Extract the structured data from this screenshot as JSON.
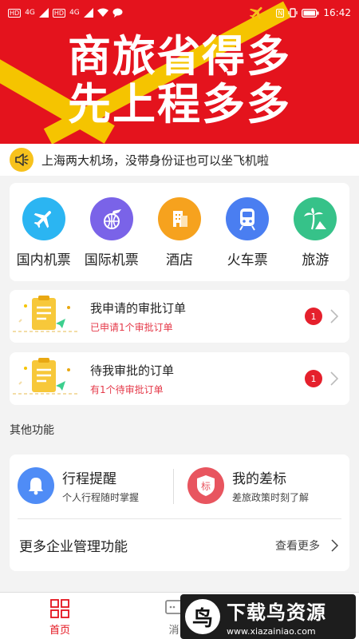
{
  "status_bar": {
    "sim1": "HD",
    "signal1": "4G",
    "sim2": "HD",
    "signal2": "4G",
    "nfc": "N",
    "time": "16:42"
  },
  "banner": {
    "line1": "商旅省得多",
    "line2": "先上程多多"
  },
  "notice": {
    "icon": "speaker-icon",
    "text": "上海两大机场，没带身份证也可以坐飞机啦"
  },
  "services": [
    {
      "label": "国内机票",
      "icon": "airplane-icon",
      "color": "#2bb5f2"
    },
    {
      "label": "国际机票",
      "icon": "globe-plane-icon",
      "color": "#7a63e8"
    },
    {
      "label": "酒店",
      "icon": "hotel-icon",
      "color": "#f6a21e"
    },
    {
      "label": "火车票",
      "icon": "train-icon",
      "color": "#4a7ef1"
    },
    {
      "label": "旅游",
      "icon": "palm-tree-icon",
      "color": "#36c289"
    }
  ],
  "approvals": [
    {
      "title": "我申请的审批订单",
      "subtitle": "已申请1个审批订单",
      "badge": "1"
    },
    {
      "title": "待我审批的订单",
      "subtitle": "有1个待审批订单",
      "badge": "1"
    }
  ],
  "other_section": {
    "title": "其他功能"
  },
  "features": [
    {
      "title": "行程提醒",
      "subtitle": "个人行程随时掌握",
      "icon": "bell-icon",
      "color": "#4f8cf6"
    },
    {
      "title": "我的差标",
      "subtitle": "差旅政策时刻了解",
      "icon": "shield-icon",
      "color": "#e8555f",
      "icon_text": "标"
    }
  ],
  "more": {
    "label": "更多企业管理功能",
    "link": "查看更多"
  },
  "bottom_nav": {
    "home": "首页",
    "message": "消"
  },
  "watermark": {
    "logo": "鸟",
    "title": "下载鸟资源",
    "url": "www.xiazainiao.com"
  },
  "colors": {
    "brand_red": "#e4131d",
    "accent_yellow": "#f5c400",
    "badge_red": "#e5202c"
  }
}
